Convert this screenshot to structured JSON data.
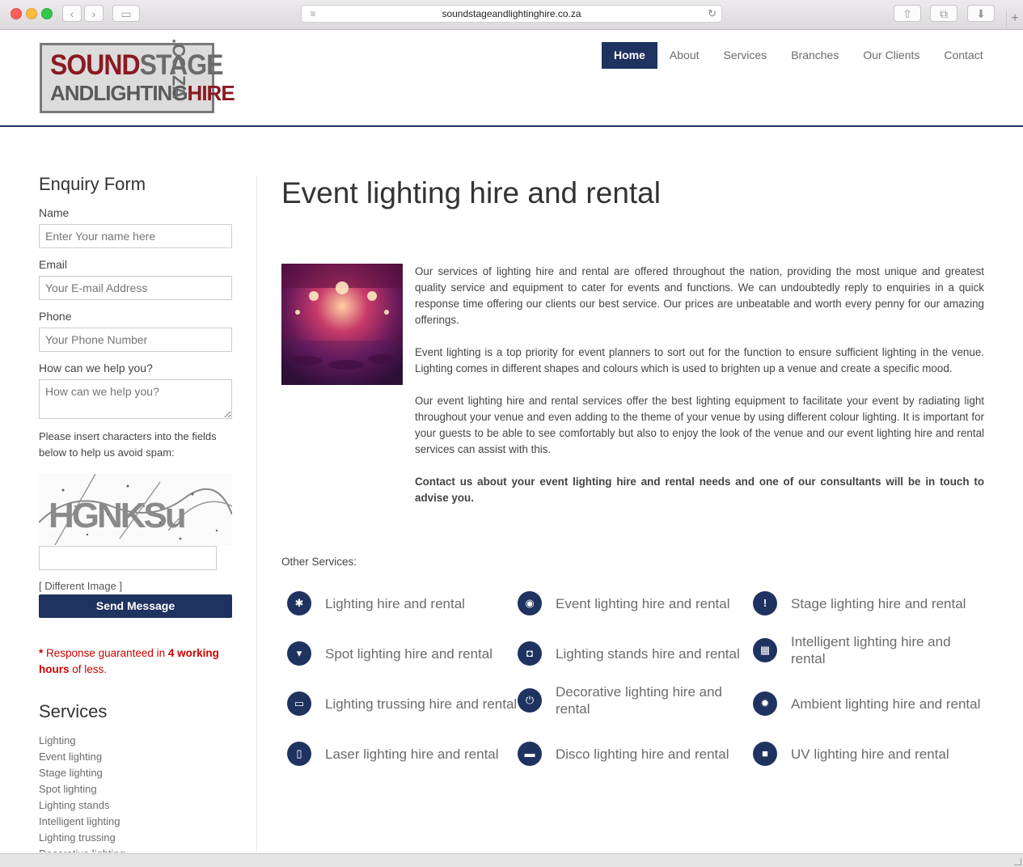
{
  "browser": {
    "url": "soundstageandlightinghire.co.za",
    "back_glyph": "‹",
    "forward_glyph": "›",
    "sidebar_glyph": "▭",
    "share_glyph": "⇧",
    "tabs_glyph": "⧉",
    "download_glyph": "⬇",
    "newtab_glyph": "+"
  },
  "logo": {
    "line1_a": "SOUND",
    "line1_b": "STAGE",
    "line2_a": "ANDLIGHTING",
    "line2_b": "HIRE",
    "suffix": ".CO.ZA"
  },
  "nav": {
    "items": [
      "Home",
      "About",
      "Services",
      "Branches",
      "Our Clients",
      "Contact"
    ],
    "active": "Home"
  },
  "enquiry": {
    "title": "Enquiry Form",
    "name_label": "Name",
    "name_placeholder": "Enter Your name here",
    "email_label": "Email",
    "email_placeholder": "Your E-mail Address",
    "phone_label": "Phone",
    "phone_placeholder": "Your Phone Number",
    "help_label": "How can we help you?",
    "help_placeholder": "How can we help you?",
    "spam_note": "Please insert characters into the fields below to help us avoid spam:",
    "captcha_text": "HGNKSu",
    "captcha_value": "",
    "different_image": "[ Different Image ]",
    "send_label": "Send Message",
    "response_star": "*",
    "response_a": "Response guaranteed in",
    "response_b": "4 working",
    "response_c": "hours",
    "response_d": "of less."
  },
  "sidebar_services": {
    "title": "Services",
    "items": [
      "Lighting",
      "Event lighting",
      "Stage lighting",
      "Spot lighting",
      "Lighting stands",
      "Intelligent lighting",
      "Lighting trussing",
      "Decorative lighting"
    ]
  },
  "main": {
    "title": "Event lighting hire and rental",
    "paragraphs": [
      "Our services of lighting hire and rental are offered throughout the nation, providing the most unique and greatest quality service and equipment to cater for events and functions. We can undoubtedly reply to enquiries in a quick response time offering our clients our best service. Our prices are unbeatable and worth every penny for our amazing offerings.",
      "Event lighting is a top priority for event planners to sort out for the function to ensure sufficient lighting in the venue. Lighting comes in different shapes and colours which is used to brighten up a venue and create a specific mood.",
      "Our event lighting hire and rental services offer the best lighting equipment to facilitate your event by radiating light throughout your venue and even adding to the theme of your venue by using different colour lighting. It is important for your guests to be able to see comfortably but also to enjoy the look of the venue and our event lighting hire and rental services can assist with this."
    ],
    "cta": "Contact us about your event lighting hire and rental needs and one of our consultants will be in touch to advise you.",
    "other_services_label": "Other Services:"
  },
  "other_services": [
    {
      "label": "Lighting hire and rental",
      "icon": "asterisk-icon",
      "glyph": "✱"
    },
    {
      "label": "Event lighting hire and rental",
      "icon": "eye-icon",
      "glyph": "◉"
    },
    {
      "label": "Stage lighting hire and rental",
      "icon": "exclamation-icon",
      "glyph": "!"
    },
    {
      "label": "Spot lighting hire and rental",
      "icon": "download-box-icon",
      "glyph": "▾"
    },
    {
      "label": "Lighting stands hire and rental",
      "icon": "camera-icon",
      "glyph": "◘"
    },
    {
      "label": "Intelligent lighting hire and rental",
      "icon": "film-icon",
      "glyph": "▦"
    },
    {
      "label": "Lighting trussing hire and rental",
      "icon": "laptop-icon",
      "glyph": "▭"
    },
    {
      "label": "Decorative lighting hire and rental",
      "icon": "power-icon",
      "glyph": "⏻"
    },
    {
      "label": "Ambient lighting hire and rental",
      "icon": "gear-icon",
      "glyph": "✹"
    },
    {
      "label": "Laser lighting hire and rental",
      "icon": "tablet-icon",
      "glyph": "▯"
    },
    {
      "label": "Disco lighting hire and rental",
      "icon": "monitor-icon",
      "glyph": "▬"
    },
    {
      "label": "UV lighting hire and rental",
      "icon": "stop-icon",
      "glyph": "■"
    }
  ],
  "colors": {
    "brand_navy": "#1f3361",
    "logo_red": "#8b1a22",
    "alert_red": "#cc0000"
  }
}
